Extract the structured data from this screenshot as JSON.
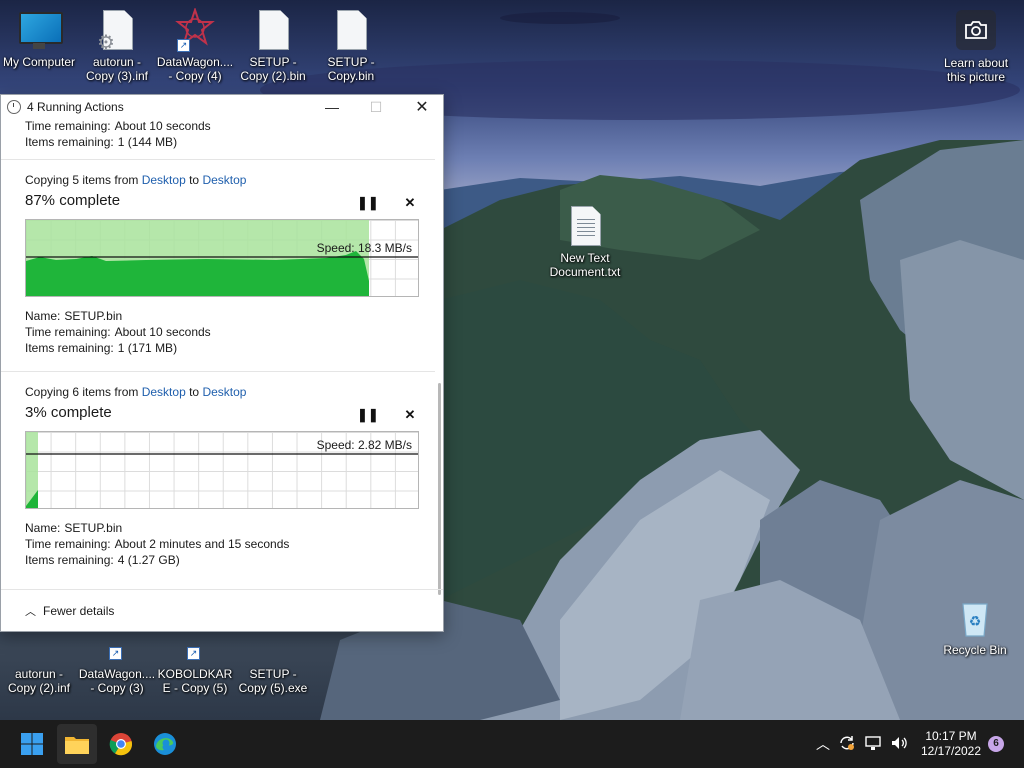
{
  "desktop": {
    "icons_top": [
      {
        "name": "my-computer",
        "label": "My Computer"
      },
      {
        "name": "autorun-copy-3",
        "label": "autorun - Copy (3).inf"
      },
      {
        "name": "datawagon-copy-4",
        "label": "DataWagon.... - Copy (4)"
      },
      {
        "name": "setup-copy-2-bin",
        "label": "SETUP - Copy (2).bin"
      },
      {
        "name": "setup-copy-bin",
        "label": "SETUP - Copy.bin"
      }
    ],
    "icons_bottom": [
      {
        "name": "autorun-copy-2",
        "label": "autorun - Copy (2).inf"
      },
      {
        "name": "datawagon-copy-3",
        "label": "DataWagon.... - Copy (3)"
      },
      {
        "name": "koboldkare-copy-5",
        "label": "KOBOLDKARE - Copy (5)"
      },
      {
        "name": "setup-copy-5-exe",
        "label": "SETUP - Copy (5).exe"
      }
    ],
    "new_text_doc": "New Text Document.txt",
    "recycle_bin": "Recycle Bin",
    "learn_about": "Learn about this picture"
  },
  "window": {
    "title": "4 Running Actions",
    "top_partial": {
      "time_label": "Time remaining:",
      "time_value": "About 10 seconds",
      "items_label": "Items remaining:",
      "items_value": "1 (144 MB)"
    },
    "ops": [
      {
        "prefix": "Copying 5 items from",
        "source": "Desktop",
        "to": "to",
        "dest": "Desktop",
        "percent_text": "87% complete",
        "percent": 87,
        "speed_text": "Speed: 18.3 MB/s",
        "speed_level": 0.52,
        "name_label": "Name:",
        "name_value": "SETUP.bin",
        "time_label": "Time remaining:",
        "time_value": "About 10 seconds",
        "items_label": "Items remaining:",
        "items_value": "1 (171 MB)"
      },
      {
        "prefix": "Copying 6 items from",
        "source": "Desktop",
        "to": "to",
        "dest": "Desktop",
        "percent_text": "3% complete",
        "percent": 3,
        "speed_text": "Speed: 2.82 MB/s",
        "speed_level": 0.72,
        "name_label": "Name:",
        "name_value": "SETUP.bin",
        "time_label": "Time remaining:",
        "time_value": "About 2 minutes and 15 seconds",
        "items_label": "Items remaining:",
        "items_value": "4 (1.27 GB)"
      }
    ],
    "fewer_details": "Fewer details",
    "colors": {
      "graph_fill": "#1fb53a",
      "graph_bg_done": "#a8e39b",
      "link": "#1f5fad"
    }
  },
  "taskbar": {
    "time": "10:17 PM",
    "date": "12/17/2022",
    "notifications": "6",
    "icons": [
      "start-icon",
      "file-explorer-icon",
      "chrome-icon",
      "edge-icon"
    ],
    "tray": [
      "chevron-up-icon",
      "sync-icon",
      "network-icon",
      "volume-icon"
    ]
  }
}
